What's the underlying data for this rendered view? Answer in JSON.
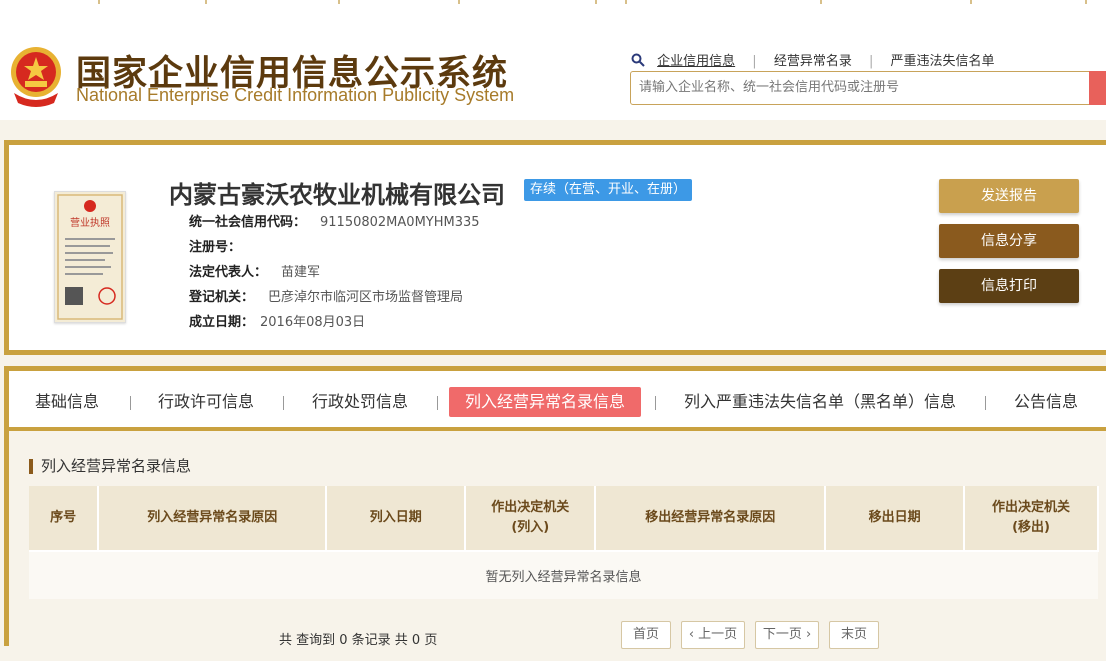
{
  "header": {
    "title_cn": "国家企业信用信息公示系统",
    "title_en": "National Enterprise Credit Information Publicity System",
    "nav": {
      "link1": "企业信用信息",
      "link2": "经营异常名录",
      "link3": "严重违法失信名单"
    },
    "search_placeholder": "请输入企业名称、统一社会信用代码或注册号"
  },
  "company": {
    "name": "内蒙古豪沃农牧业机械有限公司",
    "status": "存续（在营、开业、在册）",
    "credit_code_label": "统一社会信用代码：",
    "credit_code": "91150802MA0MYHM335",
    "reg_no_label": "注册号：",
    "reg_no": "",
    "legal_rep_label": "法定代表人：",
    "legal_rep": "苗建军",
    "authority_label": "登记机关：",
    "authority": "巴彦淖尔市临河区市场监督管理局",
    "established_label": "成立日期：",
    "established": "2016年08月03日"
  },
  "actions": {
    "send_report": "发送报告",
    "share": "信息分享",
    "print": "信息打印",
    "colors": [
      "#c9a04e",
      "#8a5a1e",
      "#5c3f14"
    ]
  },
  "tabs": {
    "t1": "基础信息",
    "t2": "行政许可信息",
    "t3": "行政处罚信息",
    "t4": "列入经营异常名录信息",
    "t5": "列入严重违法失信名单（黑名单）信息",
    "t6": "公告信息"
  },
  "section": {
    "title": "列入经营异常名录信息"
  },
  "table": {
    "headers": [
      "序号",
      "列入经营异常名录原因",
      "列入日期",
      "作出决定机关(列入)",
      "移出经营异常名录原因",
      "移出日期",
      "作出决定机关(移出)"
    ],
    "h4_line1": "作出决定机关",
    "h4_line2": "(列入)",
    "h7_line1": "作出决定机关",
    "h7_line2": "(移出)",
    "empty_text": "暂无列入经营异常名录信息"
  },
  "pagination": {
    "summary": "共 查询到 0 条记录 共 0 页",
    "first": "首页",
    "prev": "上一页",
    "next": "下一页",
    "last": "末页"
  },
  "icons": {
    "search": "search-icon",
    "emblem": "national-emblem-icon",
    "license": "business-license-icon"
  },
  "colors": {
    "gold_border": "#c9a13f",
    "status_blue": "#3d99e6",
    "active_tab": "#f06a6a"
  }
}
